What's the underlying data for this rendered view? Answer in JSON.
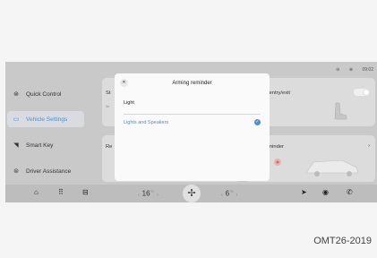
{
  "status_bar": {
    "icon_1": "person-icon",
    "icon_2": "signal-icon",
    "time": "09:02"
  },
  "sidebar": {
    "items": [
      {
        "label": "Quick Control",
        "icon": "steering-wheel-icon",
        "active": false
      },
      {
        "label": "Vehicle Settings",
        "icon": "car-icon",
        "active": true
      },
      {
        "label": "Smart Key",
        "icon": "key-icon",
        "active": false
      },
      {
        "label": "Driver Assistance",
        "icon": "steering-assist-icon",
        "active": false
      }
    ]
  },
  "cards": {
    "left_top_title": "St",
    "left_top_sub": "Se",
    "left_bottom_title": "Re",
    "right_top_title": "y entry/exit",
    "right_bottom_title": "eminder",
    "right_bottom_chevron": "›"
  },
  "modal": {
    "title": "Arming reminder",
    "close_icon": "close-icon",
    "options": [
      {
        "label": "Light",
        "selected": false
      },
      {
        "label": "Lights and Speakers",
        "selected": true
      }
    ]
  },
  "dock": {
    "left_icons": [
      "home-icon",
      "apps-icon",
      "car-icon"
    ],
    "driver_temp": "16",
    "passenger_temp": "6",
    "unit": "°C",
    "fan_icon": "fan-icon",
    "right_icons": [
      "navigation-icon",
      "media-icon",
      "phone-icon"
    ]
  },
  "caption": "OMT26-2019",
  "colors": {
    "accent": "#4b8fd6",
    "screen_bg": "#c9c9c9",
    "modal_bg": "#fafafa"
  }
}
